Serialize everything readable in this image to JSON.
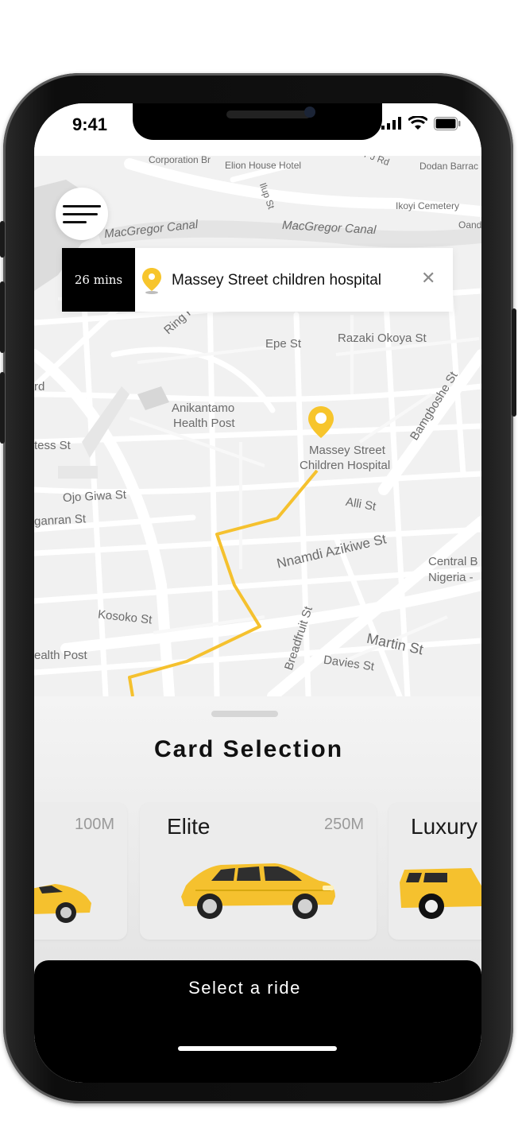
{
  "status_bar": {
    "time": "9:41"
  },
  "map": {
    "labels": {
      "corporation": "Corporation Br",
      "elion": "Elion House Hotel",
      "ilupeju": "Ilup St",
      "pj_rd": "PJ Rd",
      "dodan": "Dodan Barrac",
      "ikoyi": "Ikoyi Cemetery",
      "canal1": "MacGregor Canal",
      "canal2": "MacGregor Canal",
      "oand": "Oand",
      "ring": "Ring R",
      "epe": "Epe St",
      "razaki": "Razaki Okoya St",
      "rd": "rd",
      "anikantamo1": "Anikantamo",
      "anikantamo2": "Health Post",
      "massey1": "Massey Street",
      "massey2": "Children Hospital",
      "bamgboshe": "Bamgboshe St",
      "tess": "tess St",
      "ojo": "Ojo Giwa St",
      "ganran": "ganran St",
      "alli": "Alli St",
      "nnamdi": "Nnamdi Azikiwe St",
      "central1": "Central B",
      "central2": "Nigeria -",
      "breadfruit": "Breadfruit St",
      "kosoko": "Kosoko St",
      "martin": "Martin St",
      "davies": "Davies St",
      "health_post": "ealth Post"
    }
  },
  "destination": {
    "eta": "26 mins",
    "name": "Massey Street children hospital",
    "close": "✕"
  },
  "sheet": {
    "title": "Card Selection",
    "rides": [
      {
        "name": "",
        "price": "100M"
      },
      {
        "name": "Elite",
        "price": "250M"
      },
      {
        "name": "Luxury",
        "price": ""
      }
    ]
  },
  "cta": {
    "label": "Select a ride"
  },
  "colors": {
    "accent": "#f7c52c",
    "route": "#f5c12e",
    "dark": "#000000"
  },
  "icons": {
    "menu": "hamburger-menu-icon",
    "pin": "location-pin-icon",
    "close": "close-icon",
    "car": "yellow-car-icon"
  }
}
